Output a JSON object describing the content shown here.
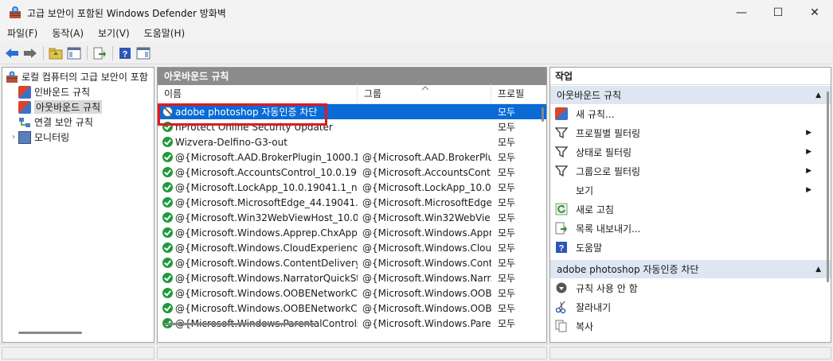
{
  "window": {
    "title": "고급 보안이 포함된 Windows Defender 방화벽",
    "minimize": "—",
    "maximize": "☐",
    "close": "✕"
  },
  "menu": [
    "파일(F)",
    "동작(A)",
    "보기(V)",
    "도움말(H)"
  ],
  "tree": {
    "root": "로컬 컴퓨터의 고급 보안이 포함",
    "items": [
      "인바운드 규칙",
      "아웃바운드 규칙",
      "연결 보안 규칙",
      "모니터링"
    ]
  },
  "middle": {
    "header": "아웃바운드 규칙",
    "columns": {
      "name": "이름",
      "group": "그룹",
      "profile": "프로필"
    },
    "rows": [
      {
        "name": "adobe photoshop 자동인증 차단",
        "group": "",
        "profile": "모두",
        "status": "block"
      },
      {
        "name": "nProtect Online Security Updater",
        "group": "",
        "profile": "모두",
        "status": "ok"
      },
      {
        "name": "Wizvera-Delfino-G3-out",
        "group": "",
        "profile": "모두",
        "status": "ok"
      },
      {
        "name": "@{Microsoft.AAD.BrokerPlugin_1000.19...",
        "group": "@{Microsoft.AAD.BrokerPlu...",
        "profile": "모두",
        "status": "ok"
      },
      {
        "name": "@{Microsoft.AccountsControl_10.0.190...",
        "group": "@{Microsoft.AccountsCont...",
        "profile": "모두",
        "status": "ok"
      },
      {
        "name": "@{Microsoft.LockApp_10.0.19041.1_ne...",
        "group": "@{Microsoft.LockApp_10.0....",
        "profile": "모두",
        "status": "ok"
      },
      {
        "name": "@{Microsoft.MicrosoftEdge_44.19041.1....",
        "group": "@{Microsoft.MicrosoftEdge...",
        "profile": "모두",
        "status": "ok"
      },
      {
        "name": "@{Microsoft.Win32WebViewHost_10.0....",
        "group": "@{Microsoft.Win32WebVie...",
        "profile": "모두",
        "status": "ok"
      },
      {
        "name": "@{Microsoft.Windows.Apprep.ChxApp_...",
        "group": "@{Microsoft.Windows.Appr...",
        "profile": "모두",
        "status": "ok"
      },
      {
        "name": "@{Microsoft.Windows.CloudExperience...",
        "group": "@{Microsoft.Windows.Clou...",
        "profile": "모두",
        "status": "ok"
      },
      {
        "name": "@{Microsoft.Windows.ContentDelivery...",
        "group": "@{Microsoft.Windows.Cont...",
        "profile": "모두",
        "status": "ok"
      },
      {
        "name": "@{Microsoft.Windows.NarratorQuickSta...",
        "group": "@{Microsoft.Windows.Narr...",
        "profile": "모두",
        "status": "ok"
      },
      {
        "name": "@{Microsoft.Windows.OOBENetworkCa...",
        "group": "@{Microsoft.Windows.OOB...",
        "profile": "모두",
        "status": "ok"
      },
      {
        "name": "@{Microsoft.Windows.OOBENetworkCa...",
        "group": "@{Microsoft.Windows.OOB...",
        "profile": "모두",
        "status": "ok"
      },
      {
        "name": "@{Microsoft.Windows.ParentalControls...",
        "group": "@{Microsoft.Windows.Pare...",
        "profile": "모두",
        "status": "ok"
      }
    ]
  },
  "actions": {
    "header": "작업",
    "section1": "아웃바운드 규칙",
    "items1": [
      "새 규칙...",
      "프로필별 필터링",
      "상태로 필터링",
      "그룹으로 필터링",
      "보기",
      "새로 고침",
      "목록 내보내기...",
      "도움말"
    ],
    "section2": "adobe photoshop 자동인증 차단",
    "items2": [
      "규칙 사용 안 함",
      "잘라내기",
      "복사"
    ]
  }
}
